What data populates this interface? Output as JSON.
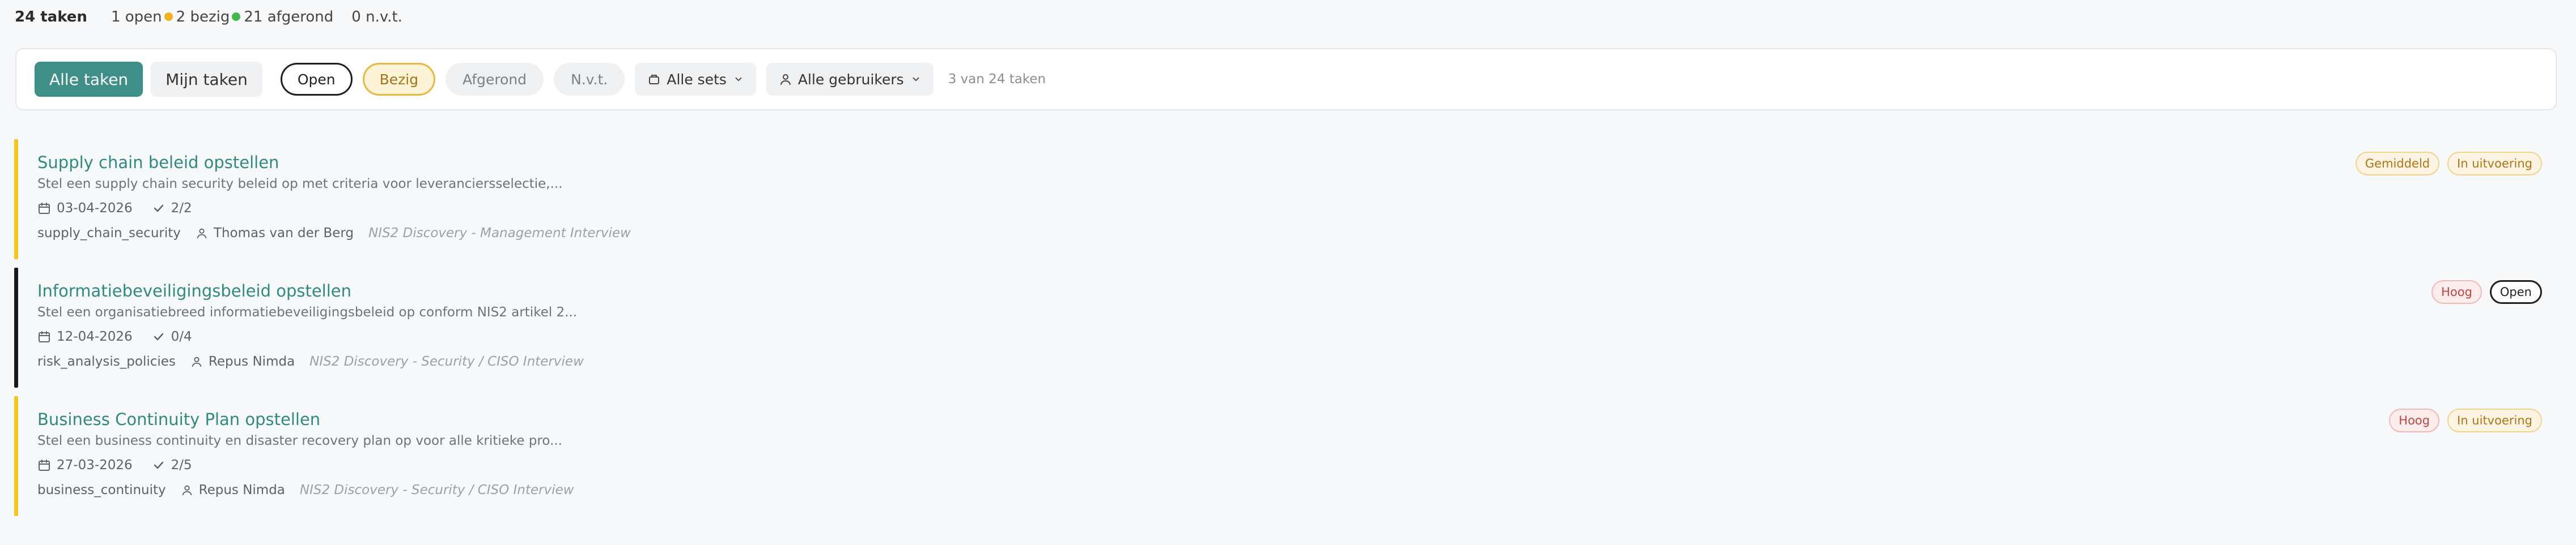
{
  "summary": {
    "total": "24 taken",
    "open": "1 open",
    "busy": "2 bezig",
    "done": "21 afgerond",
    "na": "0 n.v.t.",
    "colors": {
      "open_dot": "#f2b01e",
      "busy_dot": "#3fb950"
    }
  },
  "filters": {
    "all_tasks": "Alle taken",
    "my_tasks": "Mijn taken",
    "status": [
      "Open",
      "Bezig",
      "Afgerond",
      "N.v.t."
    ],
    "sets": "Alle sets",
    "users": "Alle gebruikers",
    "count": "3 van 24 taken"
  },
  "tasks": [
    {
      "title": "Supply chain beleid opstellen",
      "description": "Stel een supply chain security beleid op met criteria voor leveranciersselectie,...",
      "date": "03-04-2026",
      "checks": "2/2",
      "category": "supply_chain_security",
      "assignee": "Thomas van der Berg",
      "source": "NIS2 Discovery - Management Interview",
      "badges": [
        "Gemiddeld",
        "In uitvoering"
      ],
      "bar_color": "#f5c518"
    },
    {
      "title": "Informatiebeveiligingsbeleid opstellen",
      "description": "Stel een organisatiebreed informatiebeveiligingsbeleid op conform NIS2 artikel 2...",
      "date": "12-04-2026",
      "checks": "0/4",
      "category": "risk_analysis_policies",
      "assignee": "Repus Nimda",
      "source": "NIS2 Discovery - Security / CISO Interview",
      "badges": [
        "Hoog",
        "Open"
      ],
      "bar_color": "#1a1a1a"
    },
    {
      "title": "Business Continuity Plan opstellen",
      "description": "Stel een business continuity en disaster recovery plan op voor alle kritieke pro...",
      "date": "27-03-2026",
      "checks": "2/5",
      "category": "business_continuity",
      "assignee": "Repus Nimda",
      "source": "NIS2 Discovery - Security / CISO Interview",
      "badges": [
        "Hoog",
        "In uitvoering"
      ],
      "bar_color": "#f5c518"
    }
  ],
  "icons": {
    "calendar": "calendar-icon",
    "check": "check-icon",
    "user": "user-icon",
    "folder": "folder-icon",
    "chevron": "chevron-down-icon"
  }
}
